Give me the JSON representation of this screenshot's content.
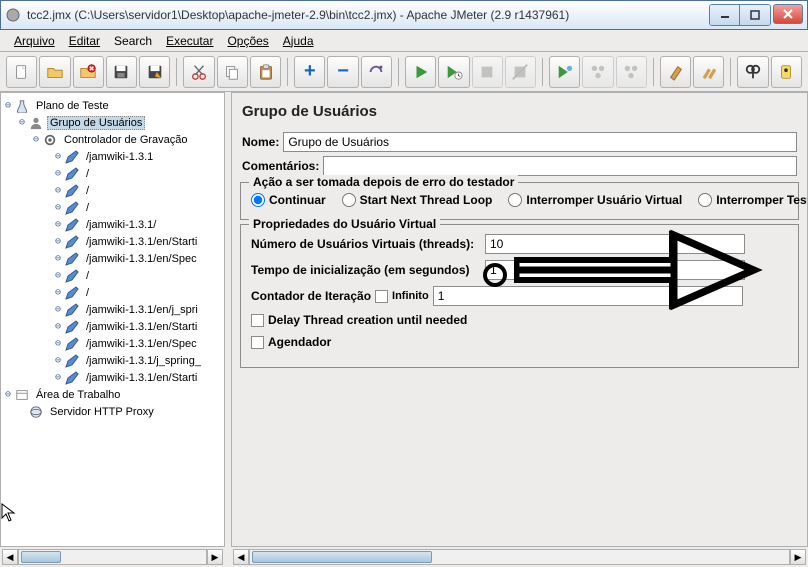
{
  "titlebar": {
    "text": "tcc2.jmx (C:\\Users\\servidor1\\Desktop\\apache-jmeter-2.9\\bin\\tcc2.jmx) - Apache JMeter (2.9 r1437961)"
  },
  "menubar": {
    "arquivo": "Arquivo",
    "editar": "Editar",
    "search": "Search",
    "executar": "Executar",
    "opcoes": "Opções",
    "ajuda": "Ajuda"
  },
  "tree": {
    "plano": "Plano de Teste",
    "grupo": "Grupo de Usuários",
    "controlador": "Controlador de Gravação",
    "items": [
      "/jamwiki-1.3.1",
      "/",
      "/",
      "/",
      "/jamwiki-1.3.1/",
      "/jamwiki-1.3.1/en/Starti",
      "/jamwiki-1.3.1/en/Spec",
      "/",
      "/",
      "/jamwiki-1.3.1/en/j_spri",
      "/jamwiki-1.3.1/en/Starti",
      "/jamwiki-1.3.1/en/Spec",
      "/jamwiki-1.3.1/j_spring_",
      "/jamwiki-1.3.1/en/Starti"
    ],
    "area": "Área de Trabalho",
    "proxy": "Servidor HTTP Proxy"
  },
  "panel": {
    "title": "Grupo de Usuários",
    "name_label": "Nome:",
    "name_value": "Grupo de Usuários",
    "comments_label": "Comentários:",
    "comments_value": "",
    "error_legend": "Ação a ser tomada depois de erro do testador",
    "radio_continuar": "Continuar",
    "radio_startnext": "Start Next Thread Loop",
    "radio_interromper_uv": "Interromper Usuário Virtual",
    "radio_interromper_test": "Interromper Test",
    "props_legend": "Propriedades do Usuário Virtual",
    "threads_label": "Número de Usuários Virtuais (threads):",
    "threads_value": "10",
    "ramp_label": "Tempo de inicialização (em segundos)",
    "ramp_value": "1",
    "loop_label": "Contador de Iteração",
    "infinito_label": "Infinito",
    "loop_value": "1",
    "delay_label": "Delay Thread creation until needed",
    "agendador_label": "Agendador"
  }
}
